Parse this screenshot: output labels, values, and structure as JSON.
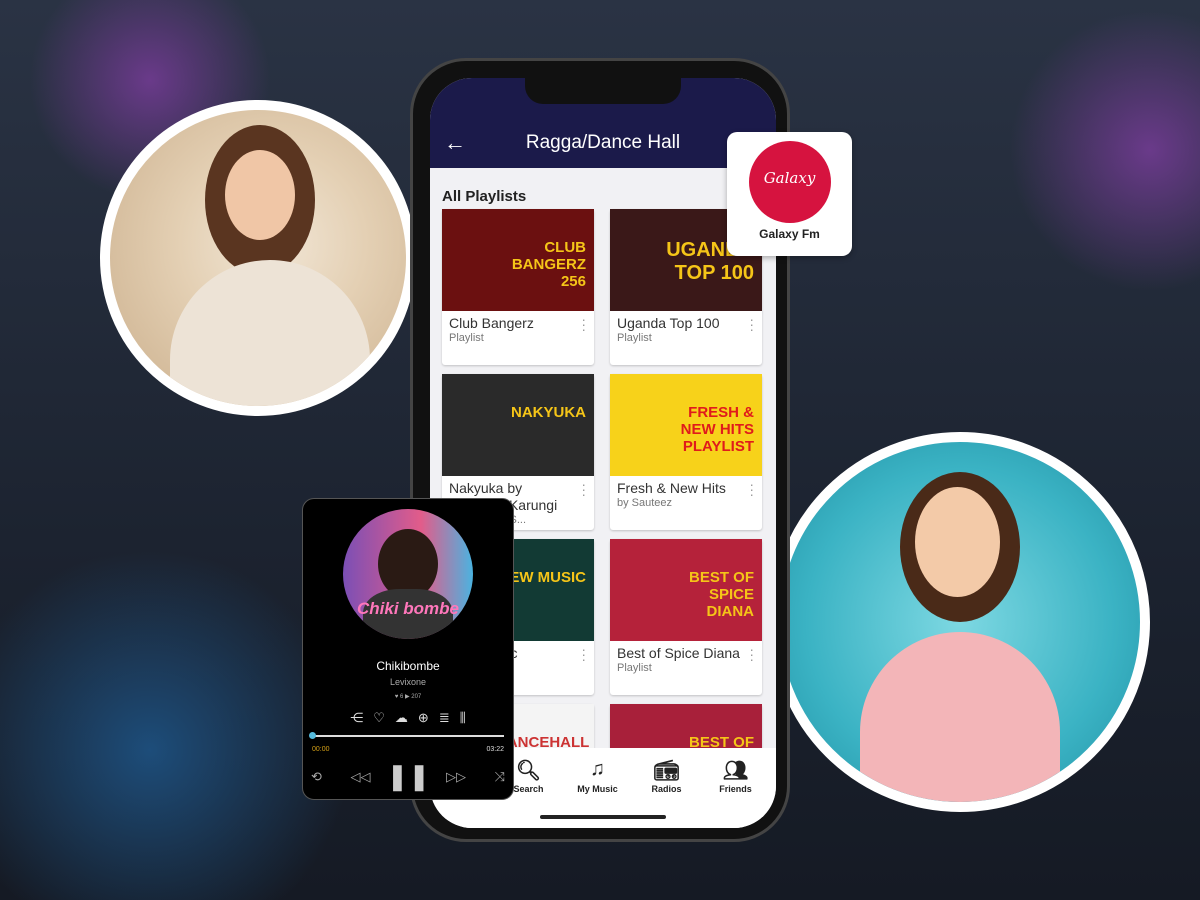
{
  "header": {
    "title": "Ragga/Dance Hall",
    "back_icon": "arrow-left-icon"
  },
  "section_title": "All Playlists",
  "playlists": [
    {
      "title": "Club Bangerz",
      "subtitle": "Playlist",
      "art_text": "CLUB BANGERZ 256",
      "color": "#6b1010"
    },
    {
      "title": "Uganda Top 100",
      "subtitle": "Playlist",
      "art_text": "UGANDA TOP 100",
      "color": "#3a1818"
    },
    {
      "title": "Nakyuka by Sheebah Karungi",
      "subtitle": "Nakyuka by S...",
      "art_text": "NAKYUKA",
      "color": "#2a2a2a"
    },
    {
      "title": "Fresh & New Hits",
      "subtitle": "by Sauteez",
      "art_text": "FRESH & NEW HITS PLAYLIST",
      "color": "#f7d21a"
    },
    {
      "title": "New Music",
      "subtitle": "",
      "art_text": "NEW MUSIC",
      "color": "#123a34"
    },
    {
      "title": "Best of Spice Diana",
      "subtitle": "Playlist",
      "art_text": "BEST OF SPICE DIANA",
      "color": "#b5223a"
    },
    {
      "title": "",
      "subtitle": "",
      "art_text": "DANCEHALL",
      "color": "#f4f4f4"
    },
    {
      "title": "",
      "subtitle": "",
      "art_text": "BEST OF",
      "color": "#a8203a"
    }
  ],
  "nav": [
    {
      "label": "Search",
      "icon": "search-icon"
    },
    {
      "label": "My Music",
      "icon": "music-note-icon"
    },
    {
      "label": "Radios",
      "icon": "radio-icon"
    },
    {
      "label": "Friends",
      "icon": "friends-icon"
    }
  ],
  "station": {
    "name": "Galaxy Fm",
    "logo_text": "Galaxy"
  },
  "player": {
    "song": "Chikibombe",
    "artist": "Levixone",
    "likes": "6",
    "plays": "207",
    "elapsed": "00:00",
    "duration": "03:22",
    "progress": 0,
    "cover_text": "Chiki bombe"
  }
}
